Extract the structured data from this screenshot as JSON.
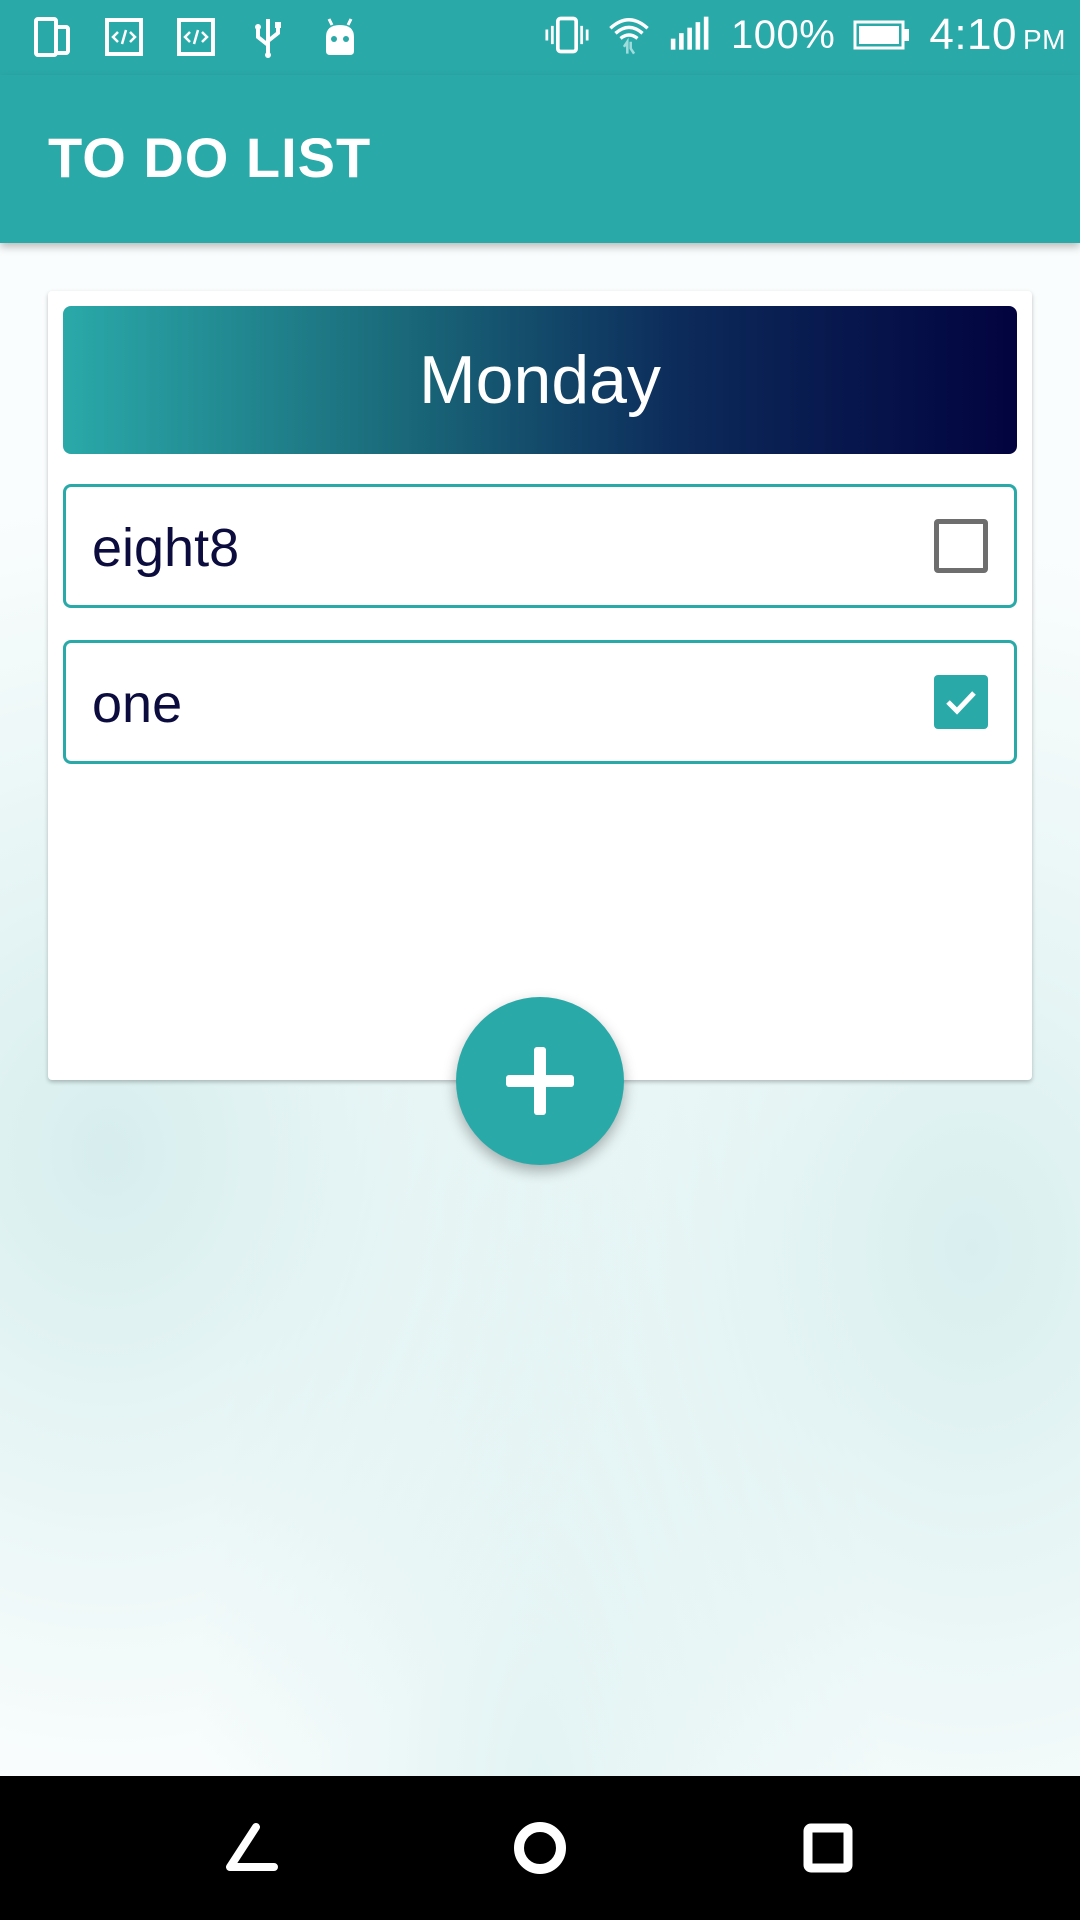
{
  "status_bar": {
    "battery_percent": "100%",
    "time": "4:10",
    "ampm": "PM",
    "left_icons": [
      "device-icon",
      "code-icon",
      "code-icon",
      "usb-icon",
      "android-icon"
    ],
    "right_icons": [
      "vibrate-icon",
      "wifi-icon",
      "signal-icon",
      "battery-icon"
    ]
  },
  "app_bar": {
    "title": "TO DO LIST"
  },
  "card": {
    "day": "Monday",
    "tasks": [
      {
        "label": "eight8",
        "checked": false
      },
      {
        "label": "one",
        "checked": true
      }
    ]
  },
  "fab": {
    "icon": "plus-icon"
  },
  "nav_bar": {
    "icons": [
      "back-icon",
      "home-icon",
      "recents-icon"
    ]
  },
  "colors": {
    "primary": "#2aa9a9",
    "header_gradient_end": "#02033f",
    "task_text": "#0c0c3e"
  }
}
